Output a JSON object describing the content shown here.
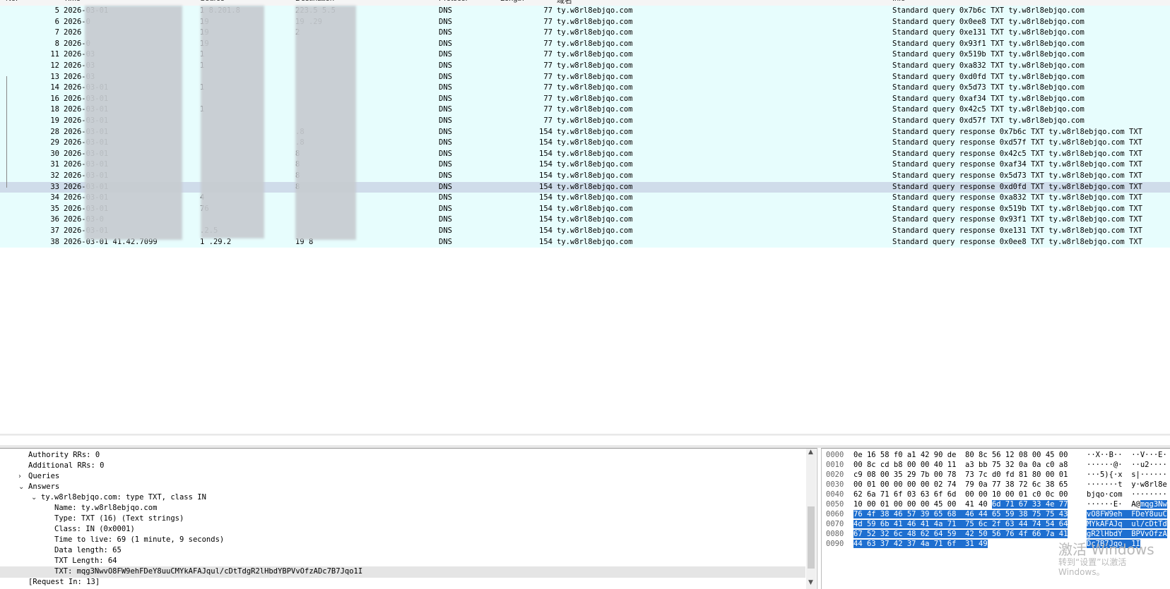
{
  "packet_list": {
    "columns": [
      "No.",
      "Time",
      "Source",
      "Destination",
      "Protocol",
      "Length",
      "域名",
      "Info"
    ],
    "rows": [
      {
        "no": "5",
        "time": "2026-03-01",
        "src": "1 8.201.8",
        "dst": "223.5 5.5",
        "proto": "DNS",
        "len": "77",
        "name": "ty.w8rl8ebjqo.com",
        "info": "Standard query 0x7b6c TXT ty.w8rl8ebjqo.com",
        "selected": false
      },
      {
        "no": "6",
        "time": "2026-0",
        "src": "19",
        "dst": "19 .29",
        "proto": "DNS",
        "len": "77",
        "name": "ty.w8rl8ebjqo.com",
        "info": "Standard query 0x0ee8 TXT ty.w8rl8ebjqo.com",
        "selected": false
      },
      {
        "no": "7",
        "time": "2026",
        "src": "19",
        "dst": "2",
        "proto": "DNS",
        "len": "77",
        "name": "ty.w8rl8ebjqo.com",
        "info": "Standard query 0xe131 TXT ty.w8rl8ebjqo.com",
        "selected": false
      },
      {
        "no": "8",
        "time": "2026-0",
        "src": "19",
        "dst": "",
        "proto": "DNS",
        "len": "77",
        "name": "ty.w8rl8ebjqo.com",
        "info": "Standard query 0x93f1 TXT ty.w8rl8ebjqo.com",
        "selected": false
      },
      {
        "no": "11",
        "time": "2026-03",
        "src": "1",
        "dst": "",
        "proto": "DNS",
        "len": "77",
        "name": "ty.w8rl8ebjqo.com",
        "info": "Standard query 0x519b TXT ty.w8rl8ebjqo.com",
        "selected": false
      },
      {
        "no": "12",
        "time": "2026-03",
        "src": "1",
        "dst": "",
        "proto": "DNS",
        "len": "77",
        "name": "ty.w8rl8ebjqo.com",
        "info": "Standard query 0xa832 TXT ty.w8rl8ebjqo.com",
        "selected": false
      },
      {
        "no": "13",
        "time": "2026-03",
        "src": "",
        "dst": "",
        "proto": "DNS",
        "len": "77",
        "name": "ty.w8rl8ebjqo.com",
        "info": "Standard query 0xd0fd TXT ty.w8rl8ebjqo.com",
        "selected": false
      },
      {
        "no": "14",
        "time": "2026-03-01",
        "src": "1",
        "dst": "",
        "proto": "DNS",
        "len": "77",
        "name": "ty.w8rl8ebjqo.com",
        "info": "Standard query 0x5d73 TXT ty.w8rl8ebjqo.com",
        "selected": false
      },
      {
        "no": "16",
        "time": "2026-03-01",
        "src": "",
        "dst": "",
        "proto": "DNS",
        "len": "77",
        "name": "ty.w8rl8ebjqo.com",
        "info": "Standard query 0xaf34 TXT ty.w8rl8ebjqo.com",
        "selected": false
      },
      {
        "no": "18",
        "time": "2026-03-01",
        "src": "1",
        "dst": "",
        "proto": "DNS",
        "len": "77",
        "name": "ty.w8rl8ebjqo.com",
        "info": "Standard query 0x42c5 TXT ty.w8rl8ebjqo.com",
        "selected": false
      },
      {
        "no": "19",
        "time": "2026-03-01",
        "src": "",
        "dst": "",
        "proto": "DNS",
        "len": "77",
        "name": "ty.w8rl8ebjqo.com",
        "info": "Standard query 0xd57f TXT ty.w8rl8ebjqo.com",
        "selected": false
      },
      {
        "no": "28",
        "time": "2026-03-01",
        "src": "",
        "dst": ".8",
        "proto": "DNS",
        "len": "154",
        "name": "ty.w8rl8ebjqo.com",
        "info": "Standard query response 0x7b6c TXT ty.w8rl8ebjqo.com TXT",
        "selected": false
      },
      {
        "no": "29",
        "time": "2026-03-01",
        "src": "",
        "dst": ".8",
        "proto": "DNS",
        "len": "154",
        "name": "ty.w8rl8ebjqo.com",
        "info": "Standard query response 0xd57f TXT ty.w8rl8ebjqo.com TXT",
        "selected": false
      },
      {
        "no": "30",
        "time": "2026-03-01",
        "src": "",
        "dst": "8",
        "proto": "DNS",
        "len": "154",
        "name": "ty.w8rl8ebjqo.com",
        "info": "Standard query response 0x42c5 TXT ty.w8rl8ebjqo.com TXT",
        "selected": false
      },
      {
        "no": "31",
        "time": "2026-03-01",
        "src": "",
        "dst": "8",
        "proto": "DNS",
        "len": "154",
        "name": "ty.w8rl8ebjqo.com",
        "info": "Standard query response 0xaf34 TXT ty.w8rl8ebjqo.com TXT",
        "selected": false
      },
      {
        "no": "32",
        "time": "2026-03-01",
        "src": "",
        "dst": "8",
        "proto": "DNS",
        "len": "154",
        "name": "ty.w8rl8ebjqo.com",
        "info": "Standard query response 0x5d73 TXT ty.w8rl8ebjqo.com TXT",
        "selected": false
      },
      {
        "no": "33",
        "time": "2026-03-01",
        "src": "",
        "dst": "8",
        "proto": "DNS",
        "len": "154",
        "name": "ty.w8rl8ebjqo.com",
        "info": "Standard query response 0xd0fd TXT ty.w8rl8ebjqo.com TXT",
        "selected": true
      },
      {
        "no": "34",
        "time": "2026-03-01",
        "src": "4",
        "dst": "",
        "proto": "DNS",
        "len": "154",
        "name": "ty.w8rl8ebjqo.com",
        "info": "Standard query response 0xa832 TXT ty.w8rl8ebjqo.com TXT",
        "selected": false
      },
      {
        "no": "35",
        "time": "2026-03-01",
        "src": "76",
        "dst": "",
        "proto": "DNS",
        "len": "154",
        "name": "ty.w8rl8ebjqo.com",
        "info": "Standard query response 0x519b TXT ty.w8rl8ebjqo.com TXT",
        "selected": false
      },
      {
        "no": "36",
        "time": "2026-03-0",
        "src": "",
        "dst": "",
        "proto": "DNS",
        "len": "154",
        "name": "ty.w8rl8ebjqo.com",
        "info": "Standard query response 0x93f1 TXT ty.w8rl8ebjqo.com TXT",
        "selected": false
      },
      {
        "no": "37",
        "time": "2026-03-01",
        "src": ".2.5",
        "dst": "",
        "proto": "DNS",
        "len": "154",
        "name": "ty.w8rl8ebjqo.com",
        "info": "Standard query response 0xe131 TXT ty.w8rl8ebjqo.com TXT",
        "selected": false
      },
      {
        "no": "38",
        "time": "2026-03-01 41.42.7099",
        "src": "1 .29.2",
        "dst": "19 8",
        "proto": "DNS",
        "len": "154",
        "name": "ty.w8rl8ebjqo.com",
        "info": "Standard query response 0x0ee8 TXT ty.w8rl8ebjqo.com TXT",
        "selected": false
      }
    ]
  },
  "details": {
    "lines": [
      {
        "indent": 40,
        "arrow": "",
        "text": "Authority RRs: 0",
        "selected": false
      },
      {
        "indent": 40,
        "arrow": "",
        "text": "Additional RRs: 0",
        "selected": false
      },
      {
        "indent": 40,
        "arrow": "›",
        "text": "Queries",
        "selected": false
      },
      {
        "indent": 40,
        "arrow": "⌄",
        "text": "Answers",
        "selected": false
      },
      {
        "indent": 58,
        "arrow": "⌄",
        "text": "ty.w8rl8ebjqo.com: type TXT, class IN",
        "selected": false
      },
      {
        "indent": 77,
        "arrow": "",
        "text": "Name: ty.w8rl8ebjqo.com",
        "selected": false
      },
      {
        "indent": 77,
        "arrow": "",
        "text": "Type: TXT (16) (Text strings)",
        "selected": false
      },
      {
        "indent": 77,
        "arrow": "",
        "text": "Class: IN (0x0001)",
        "selected": false
      },
      {
        "indent": 77,
        "arrow": "",
        "text": "Time to live: 69 (1 minute, 9 seconds)",
        "selected": false
      },
      {
        "indent": 77,
        "arrow": "",
        "text": "Data length: 65",
        "selected": false
      },
      {
        "indent": 77,
        "arrow": "",
        "text": "TXT Length: 64",
        "selected": false
      },
      {
        "indent": 77,
        "arrow": "",
        "text": "TXT: mqg3NwvO8FW9ehFDeY8uuCMYkAFAJqul/cDtTdgR2lHbdYBPVvOfzADc7B7Jqo1I",
        "selected": true
      },
      {
        "indent": 40,
        "arrow": "",
        "text": "[Request In: 13]",
        "selected": false
      }
    ]
  },
  "bytes": {
    "rows": [
      {
        "off": "0000",
        "hex_pre": "0e 16 58 f0 a1 42 90 de  80 8c 56 12 08 00 45 00",
        "hex_hl": "",
        "asc_pre": "··X··B··  ··V···E·",
        "asc_hl": ""
      },
      {
        "off": "0010",
        "hex_pre": "00 8c cd b8 00 00 40 11  a3 bb 75 32 0a 0a c0 a8",
        "hex_hl": "",
        "asc_pre": "······@·  ··u2····",
        "asc_hl": ""
      },
      {
        "off": "0020",
        "hex_pre": "c9 08 00 35 29 7b 00 78  73 7c d0 fd 81 80 00 01",
        "hex_hl": "",
        "asc_pre": "···5){·x  s|······",
        "asc_hl": ""
      },
      {
        "off": "0030",
        "hex_pre": "00 01 00 00 00 00 02 74  79 0a 77 38 72 6c 38 65",
        "hex_hl": "",
        "asc_pre": "·······t  y·w8rl8e",
        "asc_hl": ""
      },
      {
        "off": "0040",
        "hex_pre": "62 6a 71 6f 03 63 6f 6d  00 00 10 00 01 c0 0c 00",
        "hex_hl": "",
        "asc_pre": "bjqo·com  ········",
        "asc_hl": ""
      },
      {
        "off": "0050",
        "hex_pre": "10 00 01 00 00 00 45 00  41 40 ",
        "hex_hl": "6d 71 67 33 4e 77",
        "asc_pre": "······E·  A@",
        "asc_hl": "mqg3Nw"
      },
      {
        "off": "0060",
        "hex_pre": "",
        "hex_hl": "76 4f 38 46 57 39 65 68  46 44 65 59 38 75 75 43",
        "asc_pre": "",
        "asc_hl": "vO8FW9eh  FDeY8uuC"
      },
      {
        "off": "0070",
        "hex_pre": "",
        "hex_hl": "4d 59 6b 41 46 41 4a 71  75 6c 2f 63 44 74 54 64",
        "asc_pre": "",
        "asc_hl": "MYkAFAJq  ul/cDtTd"
      },
      {
        "off": "0080",
        "hex_pre": "",
        "hex_hl": "67 52 32 6c 48 62 64 59  42 50 56 76 4f 66 7a 41",
        "asc_pre": "",
        "asc_hl": "gR2lHbdY  BPVvOfzA"
      },
      {
        "off": "0090",
        "hex_pre": "",
        "hex_hl": "44 63 37 42 37 4a 71 6f  31 49",
        "asc_pre": "",
        "asc_hl": "Dc7B7Jqo  1I"
      }
    ]
  },
  "watermark": {
    "line1": "激活 Windows",
    "line2": "转到“设置”以激活 Windows。"
  }
}
